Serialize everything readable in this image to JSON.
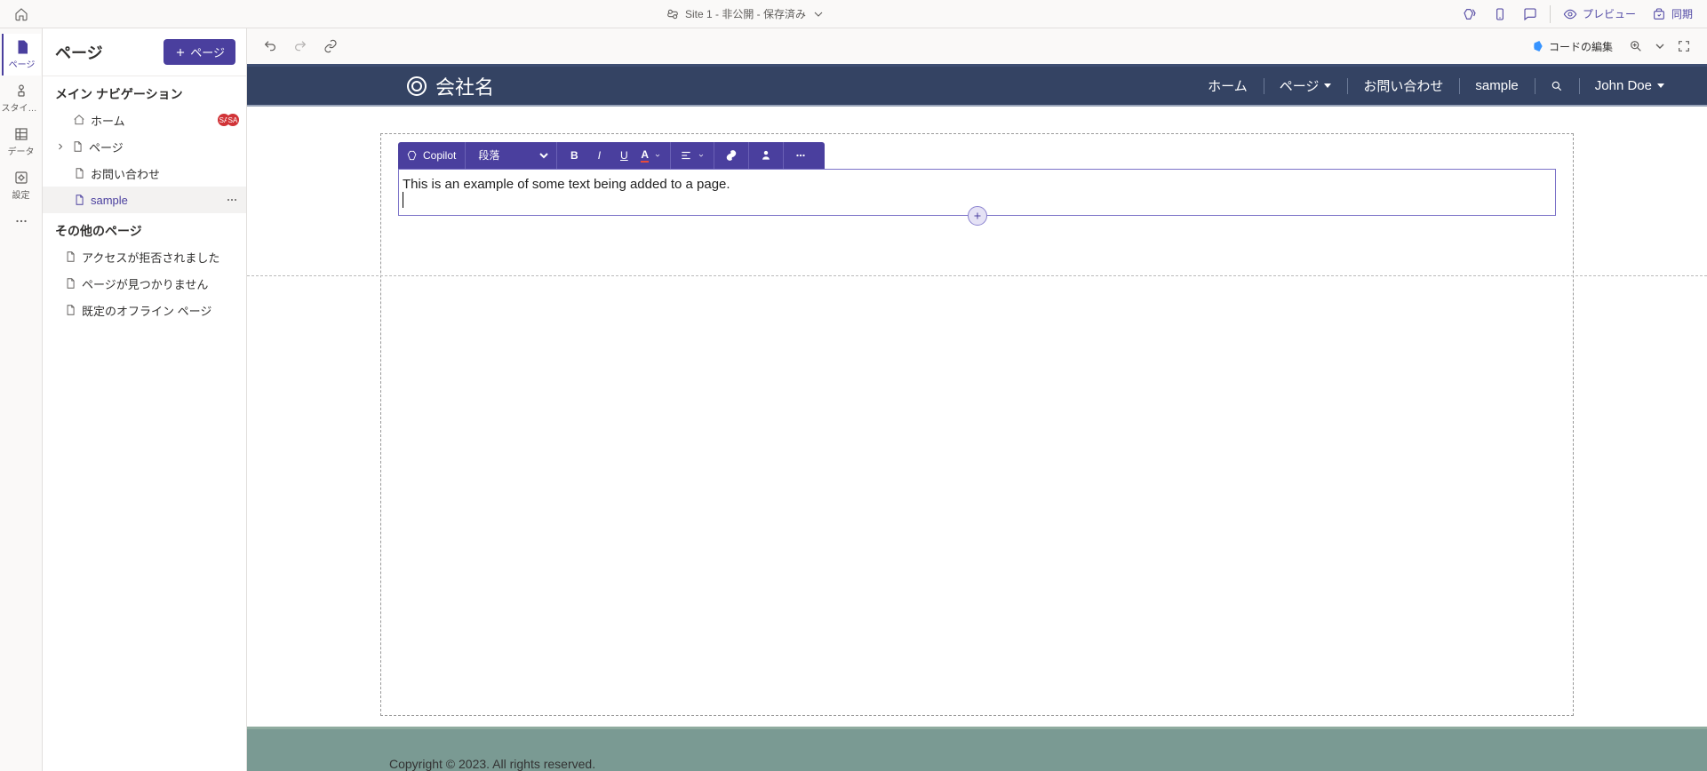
{
  "topbar": {
    "site_status": "Site 1 - 非公開 - 保存済み",
    "preview_label": "プレビュー",
    "sync_label": "同期"
  },
  "rail": {
    "items": [
      {
        "key": "pages",
        "label": "ページ"
      },
      {
        "key": "styles",
        "label": "スタイル..."
      },
      {
        "key": "data",
        "label": "データ"
      },
      {
        "key": "settings",
        "label": "設定"
      },
      {
        "key": "more",
        "label": "..."
      }
    ]
  },
  "panel": {
    "title": "ページ",
    "add_label": "ページ",
    "section_main": "メイン ナビゲーション",
    "section_other": "その他のページ",
    "main_nav": [
      {
        "label": "ホーム",
        "icon": "home",
        "indent": 0,
        "badges": [
          "SA",
          "SA"
        ]
      },
      {
        "label": "ページ",
        "icon": "page",
        "indent": 0,
        "chevron": true
      },
      {
        "label": "お問い合わせ",
        "icon": "page",
        "indent": 1
      },
      {
        "label": "sample",
        "icon": "page",
        "indent": 1,
        "selected": true,
        "more": true
      }
    ],
    "other": [
      {
        "label": "アクセスが拒否されました",
        "icon": "page"
      },
      {
        "label": "ページが見つかりません",
        "icon": "page"
      },
      {
        "label": "既定のオフライン ページ",
        "icon": "page"
      }
    ]
  },
  "canvas_toolbar": {
    "edit_code": "コードの編集"
  },
  "site": {
    "brand": "会社名",
    "nav": [
      {
        "label": "ホーム"
      },
      {
        "label": "ページ",
        "caret": true
      },
      {
        "label": "お問い合わせ"
      },
      {
        "label": "sample"
      },
      {
        "icon": "search"
      },
      {
        "label": "John Doe",
        "caret": true
      }
    ],
    "footer": "Copyright © 2023. All rights reserved."
  },
  "rte": {
    "copilot": "Copilot",
    "block_format": "段落"
  },
  "editor_text": "This is an example of some text being added to a page."
}
